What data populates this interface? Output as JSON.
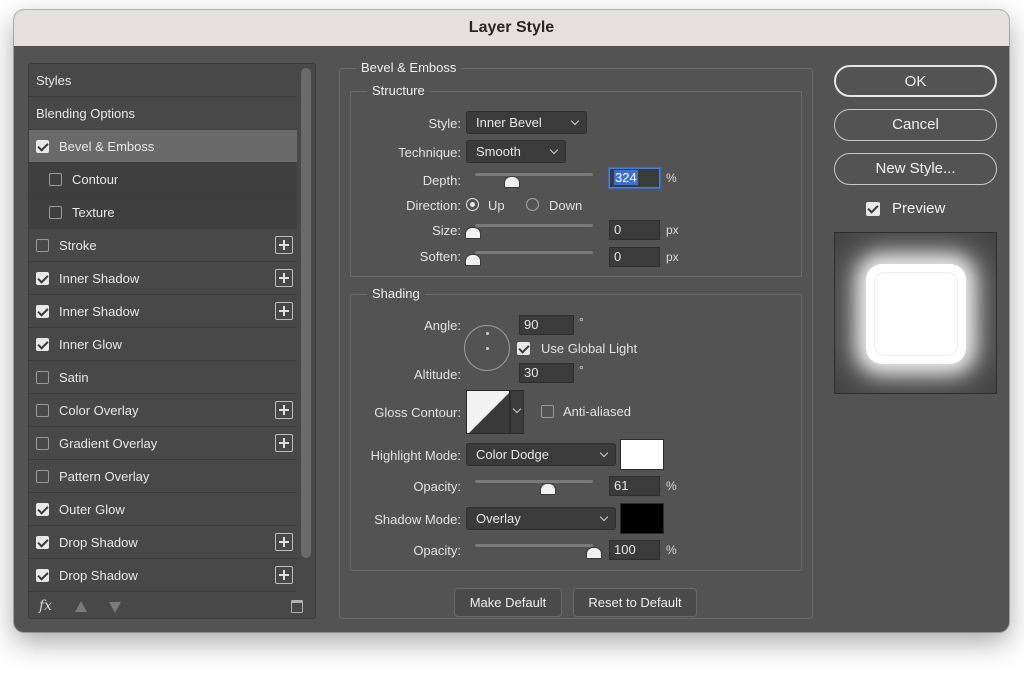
{
  "dialog": {
    "title": "Layer Style"
  },
  "styles_list": {
    "rows": [
      {
        "label": "Styles",
        "kind": "header"
      },
      {
        "label": "Blending Options",
        "kind": "header"
      },
      {
        "label": "Bevel & Emboss",
        "checked": true,
        "selected": true
      },
      {
        "label": "Contour",
        "checked": false,
        "sub": true
      },
      {
        "label": "Texture",
        "checked": false,
        "sub": true
      },
      {
        "label": "Stroke",
        "checked": false,
        "plus": true
      },
      {
        "label": "Inner Shadow",
        "checked": true,
        "plus": true
      },
      {
        "label": "Inner Shadow",
        "checked": true,
        "plus": true
      },
      {
        "label": "Inner Glow",
        "checked": true
      },
      {
        "label": "Satin",
        "checked": false
      },
      {
        "label": "Color Overlay",
        "checked": false,
        "plus": true
      },
      {
        "label": "Gradient Overlay",
        "checked": false,
        "plus": true
      },
      {
        "label": "Pattern Overlay",
        "checked": false
      },
      {
        "label": "Outer Glow",
        "checked": true
      },
      {
        "label": "Drop Shadow",
        "checked": true,
        "plus": true
      },
      {
        "label": "Drop Shadow",
        "checked": true,
        "plus": true
      }
    ],
    "footer": {
      "fx_label": "fx"
    }
  },
  "bevel_emboss": {
    "title": "Bevel & Emboss",
    "structure": {
      "title": "Structure",
      "style_label": "Style:",
      "style_value": "Inner Bevel",
      "technique_label": "Technique:",
      "technique_value": "Smooth",
      "depth_label": "Depth:",
      "depth_value": "324",
      "depth_unit": "%",
      "direction_label": "Direction:",
      "direction_up": "Up",
      "direction_down": "Down",
      "size_label": "Size:",
      "size_value": "0",
      "size_unit": "px",
      "soften_label": "Soften:",
      "soften_value": "0",
      "soften_unit": "px"
    },
    "shading": {
      "title": "Shading",
      "angle_label": "Angle:",
      "angle_value": "90",
      "angle_unit": "°",
      "global_light_label": "Use Global Light",
      "altitude_label": "Altitude:",
      "altitude_value": "30",
      "altitude_unit": "°",
      "gloss_label": "Gloss Contour:",
      "anti_aliased_label": "Anti-aliased",
      "highlight_mode_label": "Highlight Mode:",
      "highlight_mode_value": "Color Dodge",
      "highlight_opacity_label": "Opacity:",
      "highlight_opacity_value": "61",
      "highlight_opacity_unit": "%",
      "shadow_mode_label": "Shadow Mode:",
      "shadow_mode_value": "Overlay",
      "shadow_opacity_label": "Opacity:",
      "shadow_opacity_value": "100",
      "shadow_opacity_unit": "%",
      "highlight_color": "#ffffff",
      "shadow_color": "#000000"
    },
    "make_default": "Make Default",
    "reset_default": "Reset to Default"
  },
  "actions": {
    "ok": "OK",
    "cancel": "Cancel",
    "new_style": "New Style...",
    "preview_label": "Preview"
  }
}
